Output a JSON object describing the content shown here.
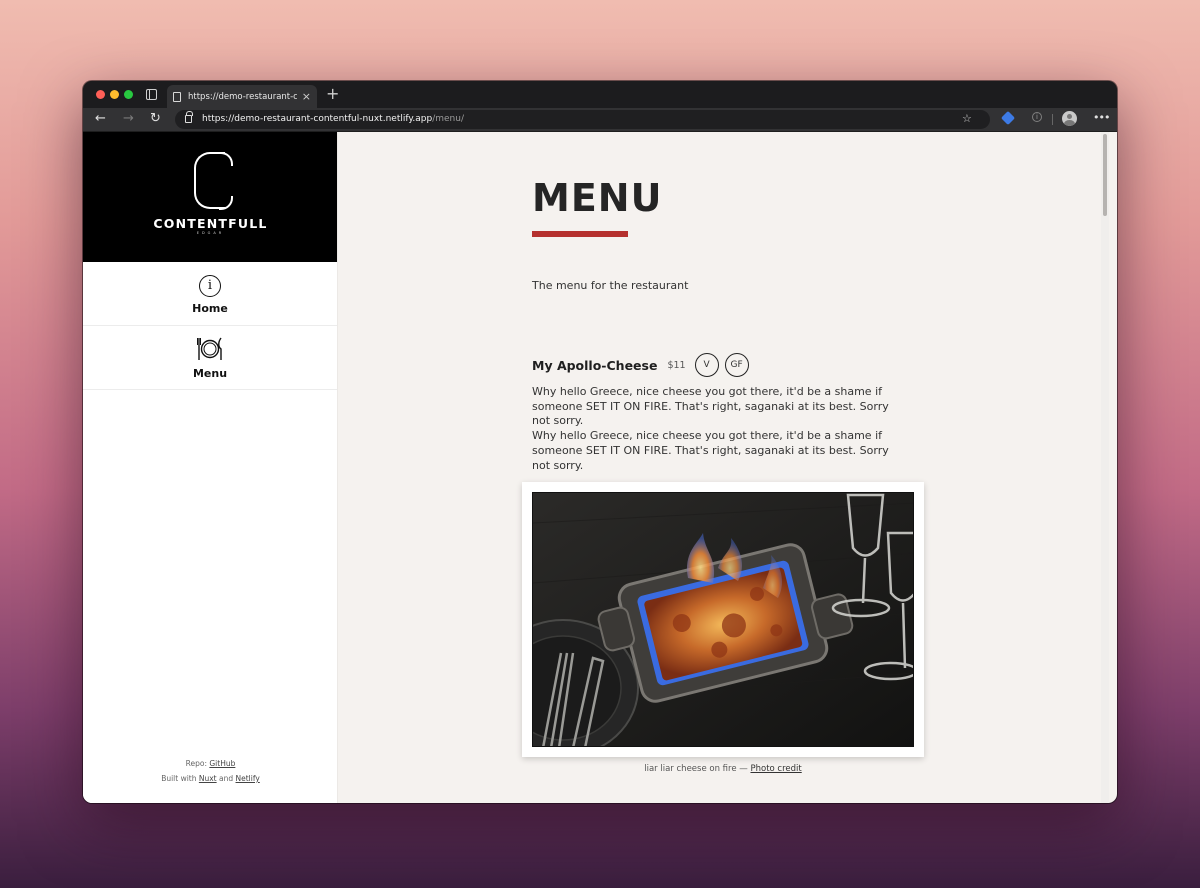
{
  "browser": {
    "tab_title": "https://demo-restaurant-contentful-nuxt.netlify.app/menu/",
    "tab_close": "×",
    "new_tab": "+",
    "url_host": "https://demo-restaurant-contentful-nuxt.netlify.app",
    "url_path": "/menu/"
  },
  "sidebar": {
    "logo_text": "CONTENTFULL",
    "logo_subtext": "EDGAR",
    "items": [
      {
        "label": "Home",
        "icon": "info-icon"
      },
      {
        "label": "Menu",
        "icon": "cutlery-plate-icon"
      }
    ],
    "footer": {
      "repo_prefix": "Repo: ",
      "repo_link": "GitHub",
      "built_prefix": "Built with ",
      "built_link_1": "Nuxt",
      "built_and": " and ",
      "built_link_2": "Netlify"
    }
  },
  "main": {
    "title": "MENU",
    "description": "The menu for the restaurant",
    "items": [
      {
        "name": "My Apollo-Cheese",
        "price": "$11",
        "badges": [
          "V",
          "GF"
        ],
        "description": [
          "Why hello Greece, nice cheese you got there, it'd be a shame if someone SET IT ON FIRE. That's right, saganaki at its best. Sorry not sorry.",
          "Why hello Greece, nice cheese you got there, it'd be a shame if someone SET IT ON FIRE. That's right, saganaki at its best. Sorry not sorry."
        ],
        "photo_caption": "liar liar cheese on fire — ",
        "photo_credit_label": "Photo credit"
      }
    ]
  },
  "colors": {
    "accent_bar": "#b5302e",
    "page_bg": "#f5f2ef",
    "sidebar_logo_bg": "#000000"
  }
}
